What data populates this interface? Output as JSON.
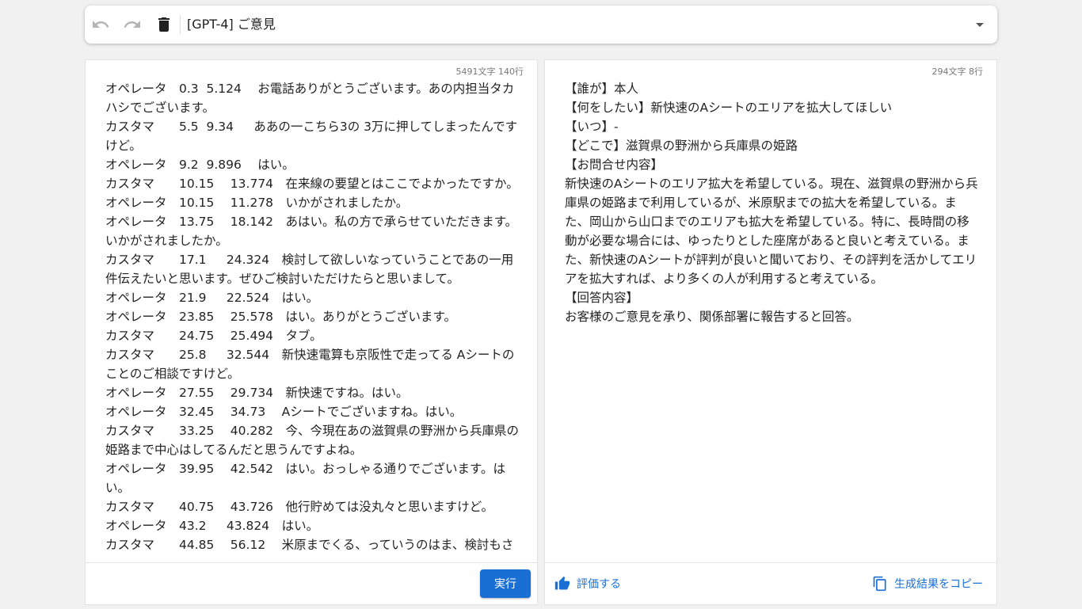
{
  "toolbar": {
    "title": "[GPT-4] ご意見",
    "undo_icon": "undo-icon",
    "redo_icon": "redo-icon",
    "delete_icon": "trash-icon",
    "dropdown_icon": "caret-down-icon"
  },
  "input_panel": {
    "count": "5491文字 140行",
    "text": "オペレータ　0.3  5.124 　お電話ありがとうございます。あの内担当タカハシでございます。\nカスタマ　　5.5  9.34  　ああの一こちら3の 3万に押してしまったんですけど。\nオペレータ　9.2  9.896 　はい。\nカスタマ　　10.15 　13.774　在来線の要望とはここでよかったですか。\nオペレータ　10.15 　11.278　いかがされましたか。\nオペレータ　13.75 　18.142　あはい。私の方で承らせていただきます。いかがされましたか。\nカスタマ　　17.1  　24.324　検討して欲しいなっていうことであの一用件伝えたいと思います。ぜひご検討いただけたらと思いまして。\nオペレータ　21.9  　22.524　はい。\nオペレータ　23.85 　25.578　はい。ありがとうございます。\nカスタマ　　24.75 　25.494　タブ。\nカスタマ　　25.8  　32.544　新快速電算も京阪性で走ってる Aシートのことのご相談ですけど。\nオペレータ　27.55 　29.734　新快速ですね。はい。\nオペレータ　32.45 　34.73 　Aシートでございますね。はい。\nカスタマ　　33.25 　40.282　今、今現在あの滋賀県の野洲から兵庫県の姫路まで中心はしてるんだと思うんですよね。\nオペレータ　39.95 　42.542　はい。おっしゃる通りでございます。はい。\nカスタマ　　40.75 　43.726　他行貯めては没丸々と思いますけど。\nオペレータ　43.2  　43.824　はい。\nカスタマ　　44.85 　56.12 　米原までくる、っていうのはま、検討もさ",
    "run_label": "実行"
  },
  "output_panel": {
    "count": "294文字 8行",
    "text": "【誰が】本人\n【何をしたい】新快速のAシートのエリアを拡大してほしい\n【いつ】-\n【どこで】滋賀県の野洲から兵庫県の姫路\n【お問合せ内容】\n新快速のAシートのエリア拡大を希望している。現在、滋賀県の野洲から兵庫県の姫路まで利用しているが、米原駅までの拡大を希望している。また、岡山から山口までのエリアも拡大を希望している。特に、長時間の移動が必要な場合には、ゆったりとした座席があると良いと考えている。また、新快速のAシートが評判が良いと聞いており、その評判を活かしてエリアを拡大すれば、より多くの人が利用すると考えている。\n【回答内容】\nお客様のご意見を承り、関係部署に報告すると回答。",
    "rate_label": "評価する",
    "rate_icon": "thumbs-up-icon",
    "copy_label": "生成結果をコピー",
    "copy_icon": "copy-icon"
  },
  "colors": {
    "accent": "#1a6fd4",
    "background": "#f1f1f1"
  }
}
